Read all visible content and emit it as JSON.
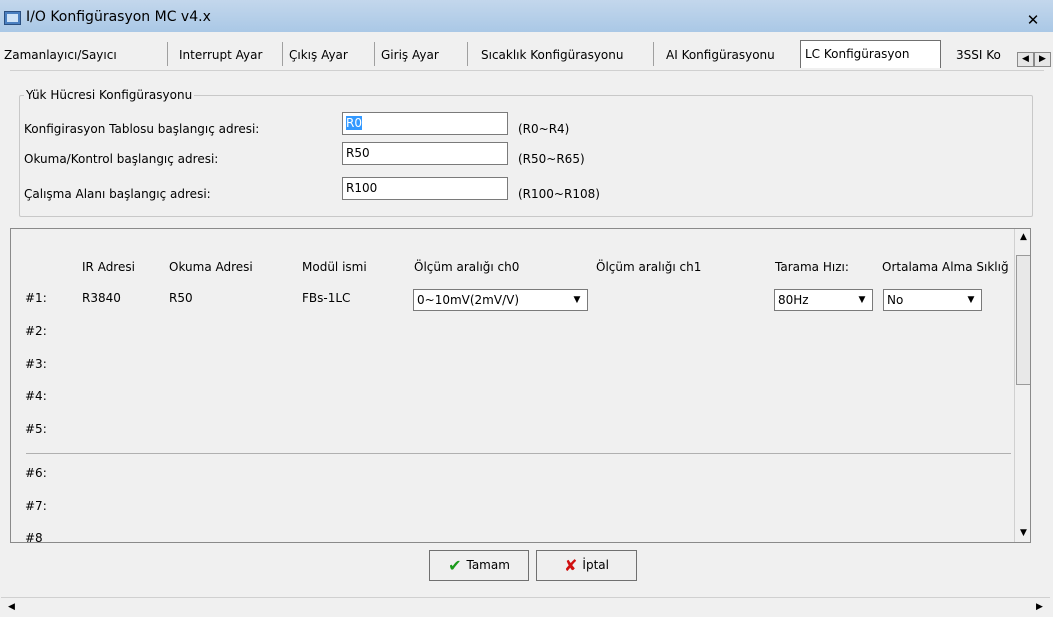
{
  "window": {
    "title": "I/O Konfigürasyon MC v4.x",
    "close_glyph": "✕"
  },
  "tabs": [
    {
      "label": "Zamanlayıcı/Sayıcı"
    },
    {
      "label": "Interrupt Ayar"
    },
    {
      "label": "Çıkış Ayar"
    },
    {
      "label": "Giriş Ayar"
    },
    {
      "label": "Sıcaklık Konfigürasyonu"
    },
    {
      "label": "AI Konfigürasyonu"
    },
    {
      "label": "LC Konfigürasyon"
    },
    {
      "label": "3SSI Ko"
    }
  ],
  "active_tab": "LC Konfigürasyon",
  "group": {
    "title": "Yük Hücresi Konfigürasyonu",
    "rows": [
      {
        "label": "Konfigirasyon Tablosu başlangıç adresi:",
        "value": "R0",
        "range": "(R0~R4)"
      },
      {
        "label": "Okuma/Kontrol başlangıç adresi:",
        "value": "R50",
        "range": "(R50~R65)"
      },
      {
        "label": "Çalışma Alanı başlangıç adresi:",
        "value": "R100",
        "range": "(R100~R108)"
      }
    ]
  },
  "table": {
    "headers": [
      "IR Adresi",
      "Okuma Adresi",
      "Modül ismi",
      "Ölçüm aralığı ch0",
      "Ölçüm aralığı ch1",
      "Tarama Hızı:",
      "Ortalama Alma Sıklığ"
    ],
    "rows": [
      "#1:",
      "#2:",
      "#3:",
      "#4:",
      "#5:",
      "#6:",
      "#7:",
      "#8"
    ],
    "row1": {
      "ir": "R3840",
      "okuma": "R50",
      "modul": "FBs-1LC",
      "ch0": "0~10mV(2mV/V)",
      "tarama": "80Hz",
      "ortalama": "No"
    }
  },
  "buttons": {
    "ok": "Tamam",
    "cancel": "İptal"
  },
  "colors": {
    "selection": "#3399ff",
    "ok_icon": "#1a9a1a",
    "cancel_icon": "#d01010"
  }
}
